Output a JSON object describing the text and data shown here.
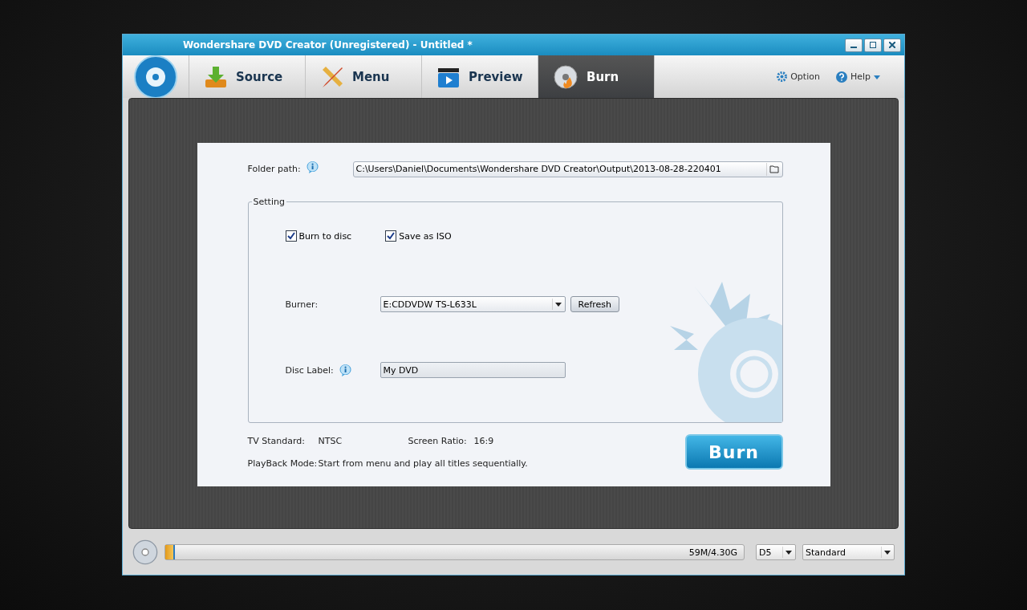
{
  "window": {
    "title": "Wondershare DVD Creator (Unregistered) - Untitled *"
  },
  "tabs": [
    {
      "label": "Source",
      "selected": false
    },
    {
      "label": "Menu",
      "selected": false
    },
    {
      "label": "Preview",
      "selected": false
    },
    {
      "label": "Burn",
      "selected": true
    }
  ],
  "toolbar_links": [
    "Option",
    "Help"
  ],
  "burn_panel": {
    "folder_path": {
      "label": "Folder path:",
      "value": "C:\\Users\\Daniel\\Documents\\Wondershare DVD Creator\\Output\\2013-08-28-220401"
    },
    "setting": {
      "title": "Setting",
      "options": [
        {
          "label": "Burn to disc",
          "checked": true
        },
        {
          "label": "Save as ISO",
          "checked": true
        }
      ],
      "burner": {
        "label": "Burner:",
        "value": "E:CDDVDW TS-L633L",
        "button": "Refresh"
      },
      "disc_label": {
        "label": "Disc Label:",
        "value": "My DVD"
      }
    },
    "info_rows": [
      [
        {
          "label": "TV Standard:",
          "value": "NTSC"
        },
        {
          "label": "Screen Ratio:",
          "value": "16:9"
        }
      ],
      [
        {
          "label": "PlayBack Mode:",
          "value": "Start from menu and play all titles sequentially."
        }
      ]
    ],
    "burn_button": "Burn"
  },
  "status_bar": {
    "capacity": {
      "level": 0.014,
      "reading": "59M/4.30G"
    },
    "disc_type": "D5",
    "quality": "Standard"
  }
}
